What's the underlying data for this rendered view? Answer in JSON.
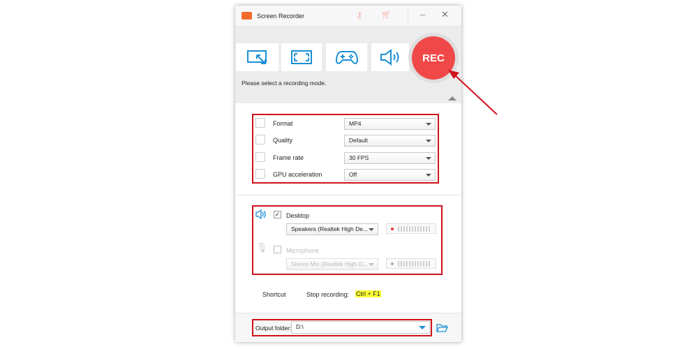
{
  "window": {
    "title": "Screen Recorder"
  },
  "toolbar": {
    "modes": [
      "region-mode",
      "fullscreen-mode",
      "game-mode",
      "audio-only-mode"
    ],
    "rec_label": "REC",
    "hint": "Please select a recording mode."
  },
  "settings": [
    {
      "label": "Format",
      "value": "MP4",
      "icon": "format-gear-icon"
    },
    {
      "label": "Quality",
      "value": "Default",
      "icon": "quality-dots-icon"
    },
    {
      "label": "Frame rate",
      "value": "30 FPS",
      "icon": "frame-rate-icon"
    },
    {
      "label": "GPU acceleration",
      "value": "Off",
      "icon": "chip-icon"
    }
  ],
  "audio": {
    "desktop": {
      "label": "Desktop",
      "checked": true,
      "device": "Speakers (Realtek High De..."
    },
    "microphone": {
      "label": "Microphone",
      "checked": false,
      "device": "Stereo Mix (Realtek High D..."
    }
  },
  "shortcut": {
    "label": "Shortcut",
    "action": "Stop recording:",
    "keys": "Ctrl + F1"
  },
  "output": {
    "label": "Output folder:",
    "value": "D:\\"
  },
  "colors": {
    "accent": "#1a8fd6",
    "rec": "#f04848",
    "highlight": "#d0121b"
  }
}
